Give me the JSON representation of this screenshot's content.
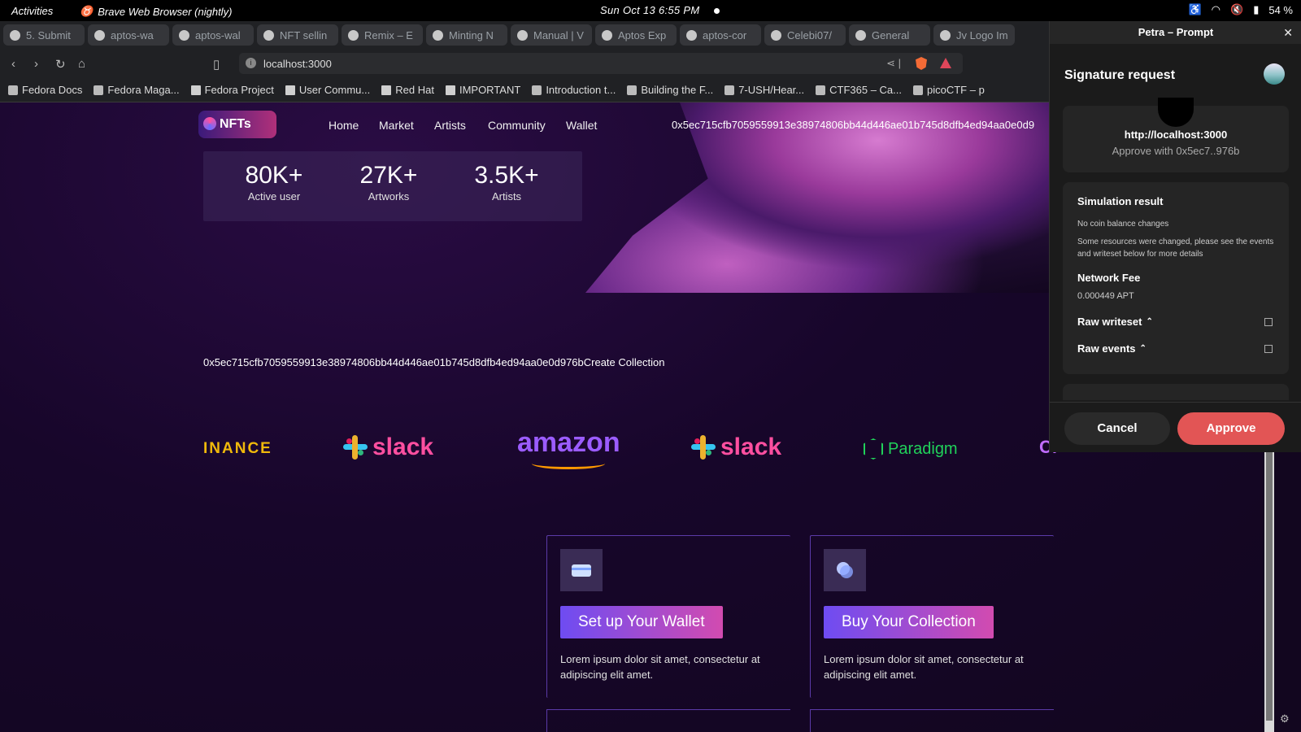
{
  "system": {
    "activities": "Activities",
    "app_name": "Brave Web Browser (nightly)",
    "clock": "Sun Oct 13   6:55 PM",
    "battery": "54 %"
  },
  "tabs": [
    {
      "label": "5. Submit"
    },
    {
      "label": "aptos-wa"
    },
    {
      "label": "aptos-wal"
    },
    {
      "label": "NFT sellin"
    },
    {
      "label": "Remix – E"
    },
    {
      "label": "Minting N"
    },
    {
      "label": "Manual | V"
    },
    {
      "label": "Aptos Exp"
    },
    {
      "label": "aptos-cor"
    },
    {
      "label": "Celebi07/"
    },
    {
      "label": "General"
    },
    {
      "label": "Jv Logo Im"
    }
  ],
  "address_bar": {
    "url": "localhost:3000"
  },
  "bookmarks": [
    {
      "label": "Fedora Docs"
    },
    {
      "label": "Fedora Maga..."
    },
    {
      "label": "Fedora Project"
    },
    {
      "label": "User Commu..."
    },
    {
      "label": "Red Hat"
    },
    {
      "label": "IMPORTANT"
    },
    {
      "label": "Introduction t..."
    },
    {
      "label": "Building the F..."
    },
    {
      "label": "7-USH/Hear..."
    },
    {
      "label": "CTF365 – Ca..."
    },
    {
      "label": "picoCTF – p"
    }
  ],
  "site": {
    "logo": "NFTs",
    "nav": {
      "home": "Home",
      "market": "Market",
      "artists": "Artists",
      "community": "Community",
      "wallet": "Wallet"
    },
    "wallet_address": "0x5ec715cfb7059559913e38974806bb44d446ae01b745d8dfb4ed94aa0e0d9",
    "stats": [
      {
        "value": "80K+",
        "label": "Active user"
      },
      {
        "value": "27K+",
        "label": "Artworks"
      },
      {
        "value": "3.5K+",
        "label": "Artists"
      }
    ],
    "create_collection_line": "0x5ec715cfb7059559913e38974806bb44d446ae01b745d8dfb4ed94aa0e0d976bCreate Collection",
    "brands": {
      "binance": "INANCE",
      "slack1": "slack",
      "amazon": "amazon",
      "slack2": "slack",
      "paradigm": "Paradigm",
      "cut": "Cr"
    },
    "cards": [
      {
        "button": "Set up Your Wallet",
        "text": "Lorem ipsum dolor sit amet, consectetur at adipiscing elit amet."
      },
      {
        "button": "Buy Your Collection",
        "text": "Lorem ipsum dolor sit amet, consectetur at adipiscing elit amet."
      }
    ]
  },
  "petra": {
    "window_title": "Petra – Prompt",
    "heading": "Signature request",
    "origin": "http://localhost:3000",
    "approve_with": "Approve with 0x5ec7..976b",
    "simulation_heading": "Simulation result",
    "no_balance": "No coin balance changes",
    "resources_changed": "Some resources were changed, please see the events and writeset below for more details",
    "fee_heading": "Network Fee",
    "fee_value": "0.000449 APT",
    "raw_writeset": "Raw writeset",
    "raw_events": "Raw events",
    "cancel": "Cancel",
    "approve": "Approve"
  },
  "colors": {
    "accent_approve": "#e25555",
    "page_bg": "#12061f",
    "card_button_gradient_start": "#6e4cf2",
    "card_button_gradient_end": "#d24bb0"
  }
}
